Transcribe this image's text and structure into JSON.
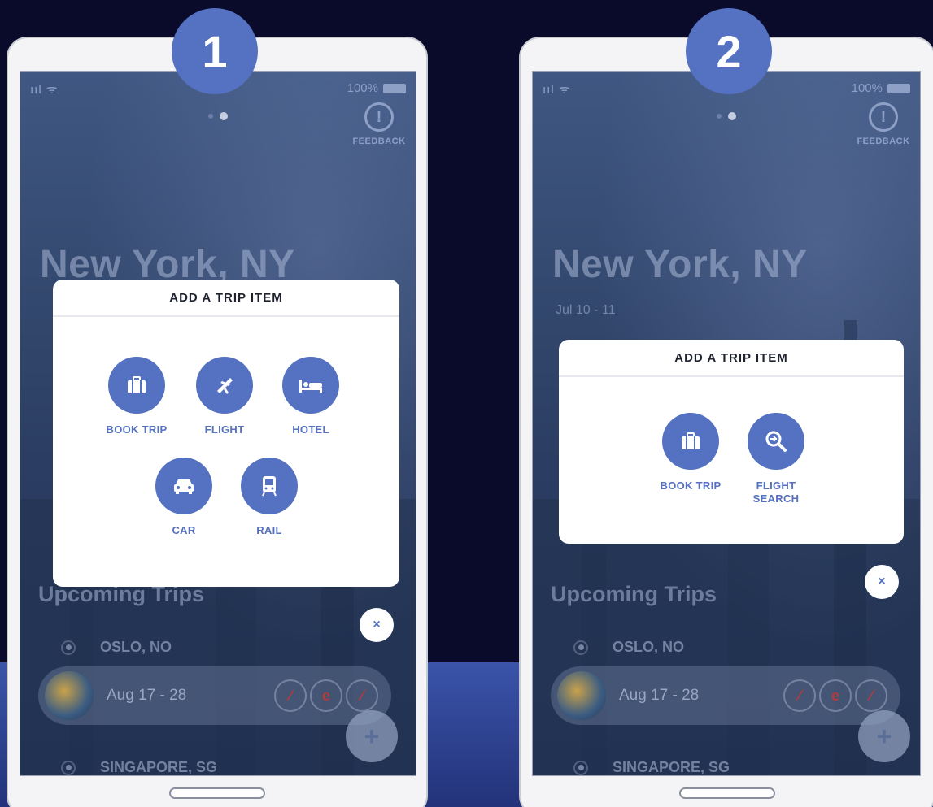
{
  "phones": [
    {
      "step": "1",
      "status": {
        "signal": "ııl ᯤ",
        "battery": "100%"
      },
      "feedback_label": "FEEDBACK",
      "city": "New York, NY",
      "dates": "",
      "upcoming": "Upcoming Trips",
      "trips": [
        {
          "city": "OSLO, NO",
          "dates": "Aug 17 - 28"
        },
        {
          "city": "SINGAPORE, SG"
        }
      ],
      "modal": {
        "title": "ADD A TRIP ITEM",
        "options": [
          {
            "label": "BOOK TRIP",
            "icon": "suitcase-icon"
          },
          {
            "label": "FLIGHT",
            "icon": "plane-icon"
          },
          {
            "label": "HOTEL",
            "icon": "bed-icon"
          },
          {
            "label": "CAR",
            "icon": "car-icon"
          },
          {
            "label": "RAIL",
            "icon": "train-icon"
          }
        ]
      }
    },
    {
      "step": "2",
      "status": {
        "signal": "ııl ᯤ",
        "battery": "100%"
      },
      "feedback_label": "FEEDBACK",
      "city": "New York, NY",
      "dates": "Jul 10 - 11",
      "upcoming": "Upcoming Trips",
      "trips": [
        {
          "city": "OSLO, NO",
          "dates": "Aug 17 - 28"
        },
        {
          "city": "SINGAPORE, SG"
        }
      ],
      "modal": {
        "title": "ADD A TRIP ITEM",
        "options": [
          {
            "label": "BOOK TRIP",
            "icon": "suitcase-icon"
          },
          {
            "label": "FLIGHT SEARCH",
            "icon": "flight-search-icon"
          }
        ]
      }
    }
  ],
  "icons": {
    "close": "×",
    "add": "+",
    "feedback": "!"
  },
  "colors": {
    "accent": "#5571c1",
    "background": "#0a0a2a",
    "stripe": "#3a54a8"
  }
}
